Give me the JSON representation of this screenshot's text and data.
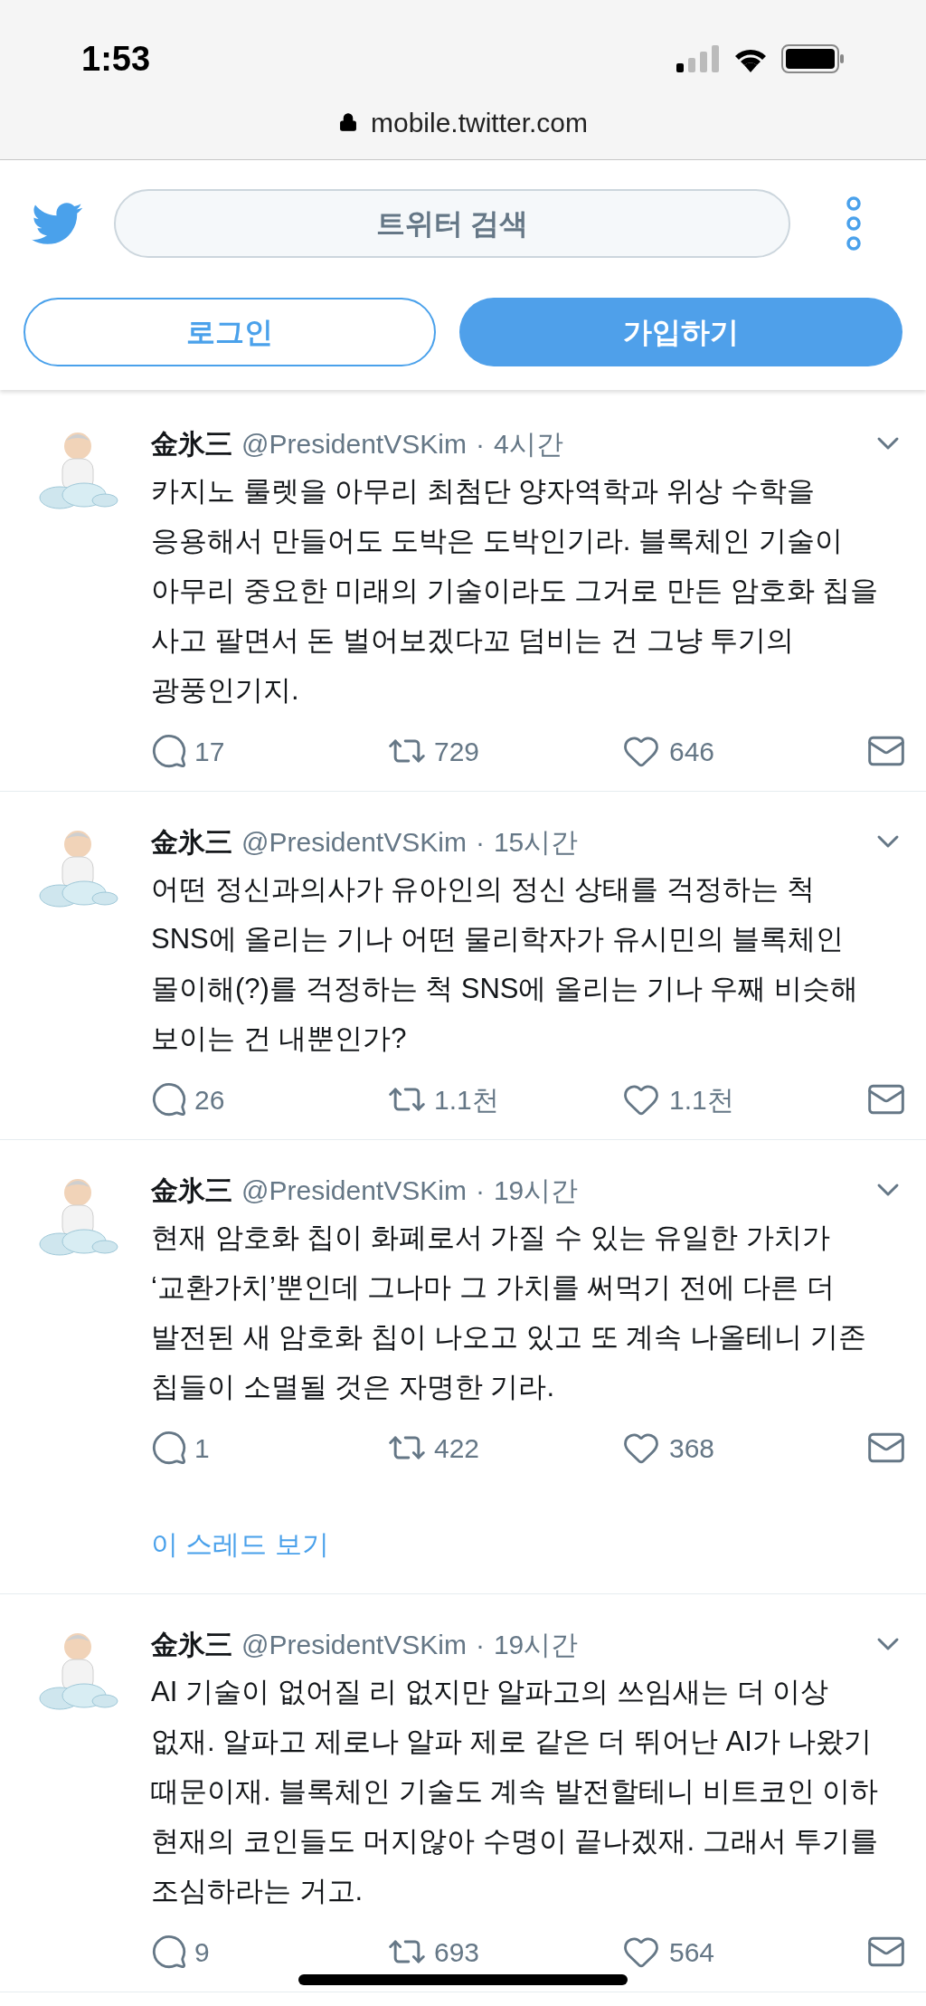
{
  "status_bar": {
    "time": "1:53",
    "url": "mobile.twitter.com"
  },
  "header": {
    "search": {
      "placeholder": "트위터 검색"
    },
    "login_button": "로그인",
    "signup_button": "가입하기"
  },
  "tweets": [
    {
      "name": "金氷三",
      "handle": "@PresidentVSKim",
      "separator": "·",
      "time": "4시간",
      "text": "카지노 룰렛을 아무리 최첨단 양자역학과 위상 수학을 응용해서 만들어도 도박은 도박인기라. 블록체인 기술이 아무리 중요한 미래의 기술이라도 그거로 만든 암호화 칩을 사고 팔면서 돈 벌어보겠다꼬 덤비는 건 그냥 투기의 광풍인기지.",
      "replies": "17",
      "retweets": "729",
      "likes": "646"
    },
    {
      "name": "金氷三",
      "handle": "@PresidentVSKim",
      "separator": "·",
      "time": "15시간",
      "text": "어떤 정신과의사가 유아인의 정신 상태를 걱정하는 척 SNS에 올리는 기나 어떤 물리학자가 유시민의 블록체인 몰이해(?)를 걱정하는 척 SNS에 올리는 기나 우째 비슷해 보이는 건 내뿐인가?",
      "replies": "26",
      "retweets": "1.1천",
      "likes": "1.1천"
    },
    {
      "name": "金氷三",
      "handle": "@PresidentVSKim",
      "separator": "·",
      "time": "19시간",
      "text": "현재 암호화 칩이 화폐로서 가질 수 있는 유일한 가치가 ‘교환가치’뿐인데 그나마 그 가치를 써먹기 전에 다른 더 발전된 새 암호화 칩이 나오고 있고 또 계속 나올테니 기존 칩들이 소멸될 것은 자명한 기라.",
      "replies": "1",
      "retweets": "422",
      "likes": "368",
      "thread_link": "이 스레드 보기"
    },
    {
      "name": "金氷三",
      "handle": "@PresidentVSKim",
      "separator": "·",
      "time": "19시간",
      "text": "AI 기술이 없어질 리 없지만 알파고의 쓰임새는 더 이상 없재. 알파고 제로나 알파 제로 같은 더 뛰어난 AI가 나왔기 때문이재. 블록체인 기술도 계속 발전할테니 비트코인 이하 현재의 코인들도 머지않아 수명이 끝나겠재. 그래서 투기를 조심하라는 거고.",
      "replies": "9",
      "retweets": "693",
      "likes": "564"
    }
  ]
}
